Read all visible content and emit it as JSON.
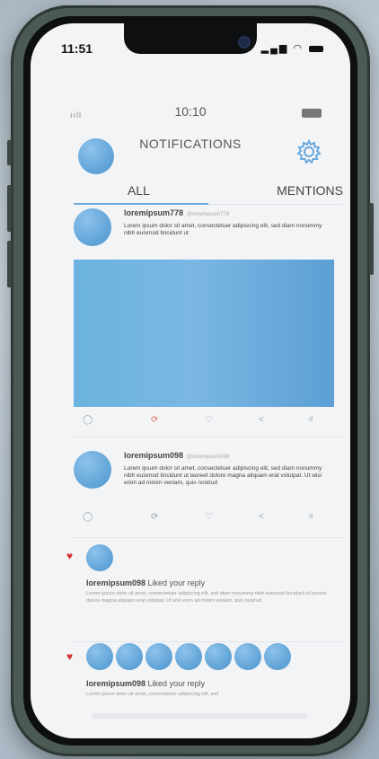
{
  "os": {
    "time": "11:51",
    "signal_icons": "▂▄▆ ◠"
  },
  "app_status": {
    "signal": "ııll",
    "time": "10:10"
  },
  "header": {
    "title": "NOTIFICATIONS"
  },
  "tabs": [
    {
      "label": "ALL"
    },
    {
      "label": "MENTIONS"
    }
  ],
  "posts": [
    {
      "user": "loremipsum778",
      "handle": "@loremipsum778",
      "body": "Lorem ipsum dolor sit amet, consectetuer adipiscing elit, sed diam nonummy nibh euismod tincidunt ut",
      "has_media": true,
      "actions": {
        "reply": "◯",
        "retweet": "⟳",
        "like": "♡",
        "share": "<",
        "stats": "ıl"
      }
    },
    {
      "user": "loremipsum098",
      "handle": "@loremipsum098",
      "body": "Lorem ipsum dolor sit amet, consectetuer adipiscing elit, sed diam nonummy nibh euismod tincidunt ut laoreet dolore magna aliquam erat volutpat. Ut wisi enim ad minim veniam, quis nostrud",
      "has_media": false,
      "actions": {
        "reply": "◯",
        "retweet": "⟳",
        "like": "♡",
        "share": "<",
        "stats": "ıl"
      }
    }
  ],
  "notifications": [
    {
      "icon": "heart-icon",
      "user": "loremipsum098",
      "action": "Liked your reply",
      "text": "Lorem ipsum dolor sit amet, consectetuer adipiscing elit, sed diam nonummy nibh euismod tincidunt ut laoreet dolore magna aliquam erat volutpat. Ut wisi enim ad minim veniam, quis nostrud",
      "avatar_count": 1
    },
    {
      "icon": "heart-icon",
      "user": "loremipsum098",
      "action": "Liked your reply",
      "text": "Lorem ipsum dolor sit amet, consectetuer adipiscing elit, sed",
      "avatar_count": 7
    }
  ],
  "colors": {
    "accent": "#6aa9dc",
    "avatar_blue": "#5ea2d6",
    "like_red": "#d83030",
    "retweet_active": "#e07060",
    "screen_bg": "#f3f4f6"
  }
}
